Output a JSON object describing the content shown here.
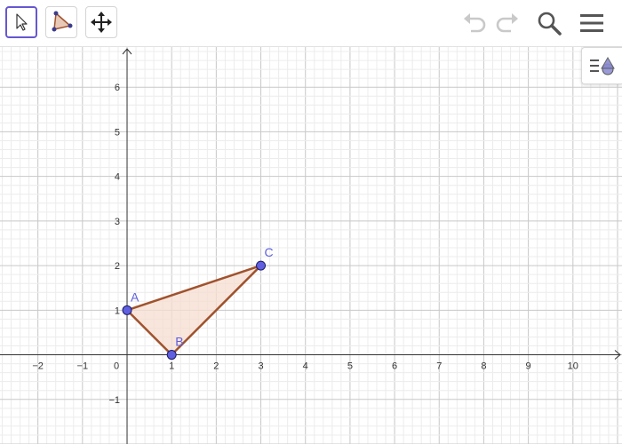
{
  "toolbar": {
    "tools": [
      {
        "id": "move",
        "icon": "arrow-pointer-icon",
        "selected": true
      },
      {
        "id": "polygon",
        "icon": "polygon-tool-icon",
        "selected": false
      },
      {
        "id": "move-graphics",
        "icon": "move-graphics-view-icon",
        "selected": false
      }
    ],
    "right_icons": [
      "undo-icon",
      "redo-icon",
      "search-icon",
      "menu-icon"
    ],
    "accent_color": "#6557d2"
  },
  "graphics": {
    "x_axis": {
      "min": -2.85,
      "max": 11.1,
      "ticks": [
        "−2",
        "−1",
        "0",
        "1",
        "2",
        "3",
        "4",
        "5",
        "6",
        "7",
        "8",
        "9",
        "10"
      ]
    },
    "y_axis": {
      "min": -2.0,
      "max": 6.9,
      "ticks": [
        "−1",
        "1",
        "2",
        "3",
        "4",
        "5",
        "6"
      ]
    },
    "grid": true,
    "points": [
      {
        "label": "A",
        "x": 0,
        "y": 1
      },
      {
        "label": "B",
        "x": 1,
        "y": 0
      },
      {
        "label": "C",
        "x": 3,
        "y": 2
      }
    ],
    "polygon": {
      "vertices": [
        "A",
        "B",
        "C"
      ],
      "stroke": "#a0522d",
      "fill": "#f5ddd0"
    },
    "point_color": "#5f5fe0"
  },
  "style_bar_icon": "graphics-style-bar-icon"
}
